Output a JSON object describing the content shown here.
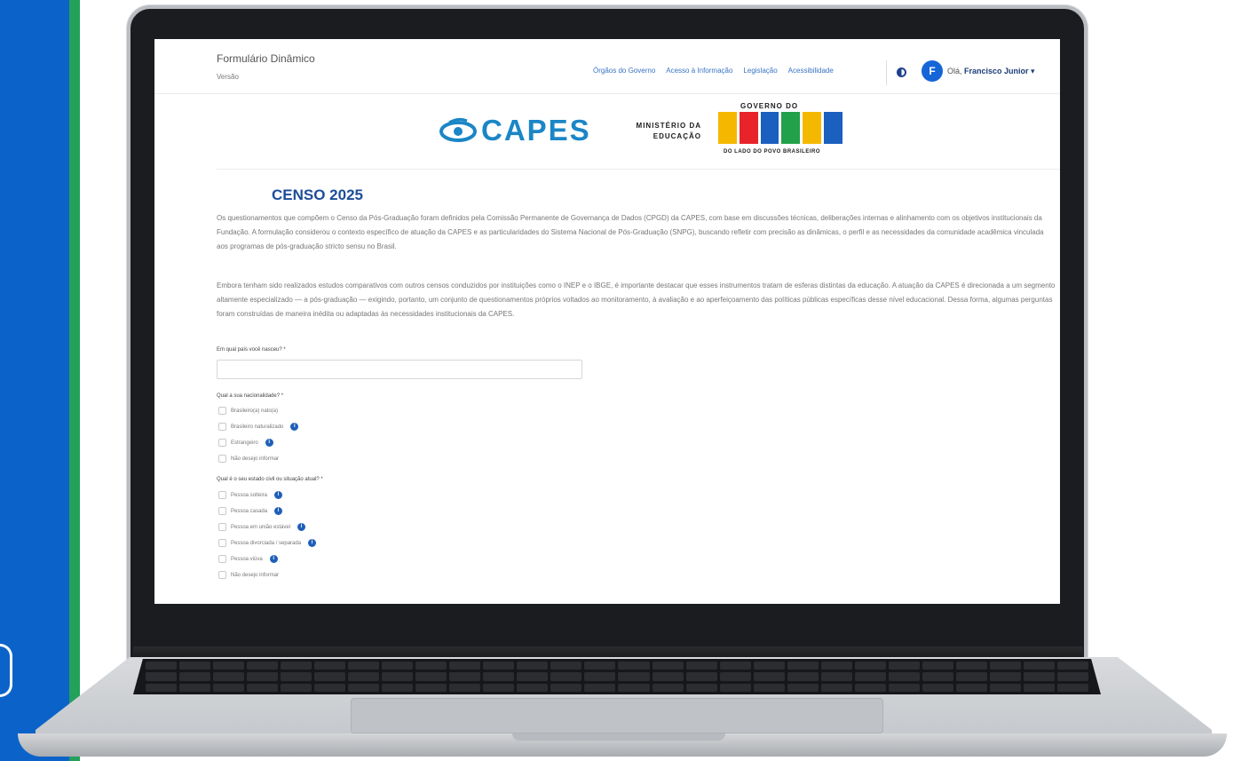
{
  "app": {
    "title": "Formulário Dinâmico",
    "version": "Versão"
  },
  "nav": {
    "items": [
      "Órgãos do Governo",
      "Acesso à Informação",
      "Legislação",
      "Acessibilidade"
    ]
  },
  "user": {
    "avatar_letter": "F",
    "greeting": "Olá,",
    "name": "Francisco Junior ▾"
  },
  "logos": {
    "capes": "CAPES",
    "ministerio_line1": "MINISTÉRIO DA",
    "ministerio_line2": "EDUCAÇÃO",
    "gov_top": "GOVERNO DO",
    "gov_bottom": "DO LADO DO POVO BRASILEIRO",
    "gov_colors": [
      "#f5b800",
      "#e8232a",
      "#1b5fbf",
      "#23a14a",
      "#f5b800",
      "#1b5fbf"
    ]
  },
  "page": {
    "title": "CENSO 2025",
    "paragraph1": "Os questionamentos que compõem o Censo da Pós-Graduação foram definidos pela Comissão Permanente de Governança de Dados (CPGD) da CAPES, com base em discussões técnicas, deliberações internas e alinhamento com os objetivos institucionais da Fundação. A formulação considerou o contexto específico de atuação da CAPES e as particularidades do Sistema Nacional de Pós-Graduação (SNPG), buscando refletir com precisão as dinâmicas, o perfil e as necessidades da comunidade acadêmica vinculada aos programas de pós-graduação stricto sensu no Brasil.",
    "paragraph2": "Embora tenham sido realizados estudos comparativos com outros censos conduzidos por instituições como o INEP e o IBGE, é importante destacar que esses instrumentos tratam de esferas distintas da educação. A atuação da CAPES é direcionada a um segmento altamente especializado — a pós-graduação — exigindo, portanto, um conjunto de questionamentos próprios voltados ao monitoramento, à avaliação e ao aperfeiçoamento das políticas públicas específicas desse nível educacional. Dessa forma, algumas perguntas foram construídas de maneira inédita ou adaptadas às necessidades institucionais da CAPES."
  },
  "questions": {
    "country_label": "Em qual país você nasceu? *",
    "country_value": "",
    "nationality_label": "Qual a sua nacionalidade? *",
    "nationality_options": [
      {
        "label": "Brasileiro(a) nato(a)",
        "info": false
      },
      {
        "label": "Brasileiro naturalizado",
        "info": true
      },
      {
        "label": "Estrangeiro",
        "info": true
      },
      {
        "label": "Não desejo informar",
        "info": false
      }
    ],
    "marital_label": "Qual é o seu estado civil ou situação atual? *",
    "marital_options": [
      {
        "label": "Pessoa solteira",
        "info": true
      },
      {
        "label": "Pessoa casada",
        "info": true
      },
      {
        "label": "Pessoa em união estável",
        "info": true
      },
      {
        "label": "Pessoa divorciada / separada",
        "info": true
      },
      {
        "label": "Pessoa viúva",
        "info": true
      },
      {
        "label": "Não desejo informar",
        "info": false
      }
    ]
  }
}
